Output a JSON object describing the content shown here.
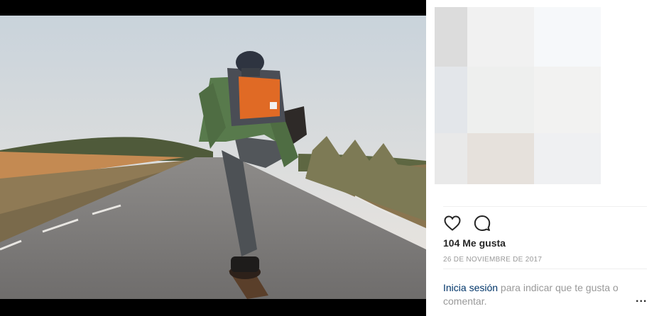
{
  "post": {
    "image_alt": "Skateboarder on an empty road with an orange backpack"
  },
  "mosaic": {
    "colors": [
      "#dcdcdc",
      "#f1f1f1",
      "#f6f8fa",
      "#e3e6ea",
      "#eeefee",
      "#f2f2f1",
      "#e9e9e9",
      "#e6e1dc",
      "#eff0f2"
    ]
  },
  "actions": {
    "like_icon": "heart-icon",
    "comment_icon": "comment-icon"
  },
  "likes": {
    "text": "104 Me gusta"
  },
  "timestamp": {
    "text": "26 DE NOVIEMBRE DE 2017"
  },
  "login_prompt": {
    "link_label": "Inicia sesión",
    "rest": " para indicar que te gusta o comentar."
  },
  "more_options": {
    "label": "..."
  }
}
